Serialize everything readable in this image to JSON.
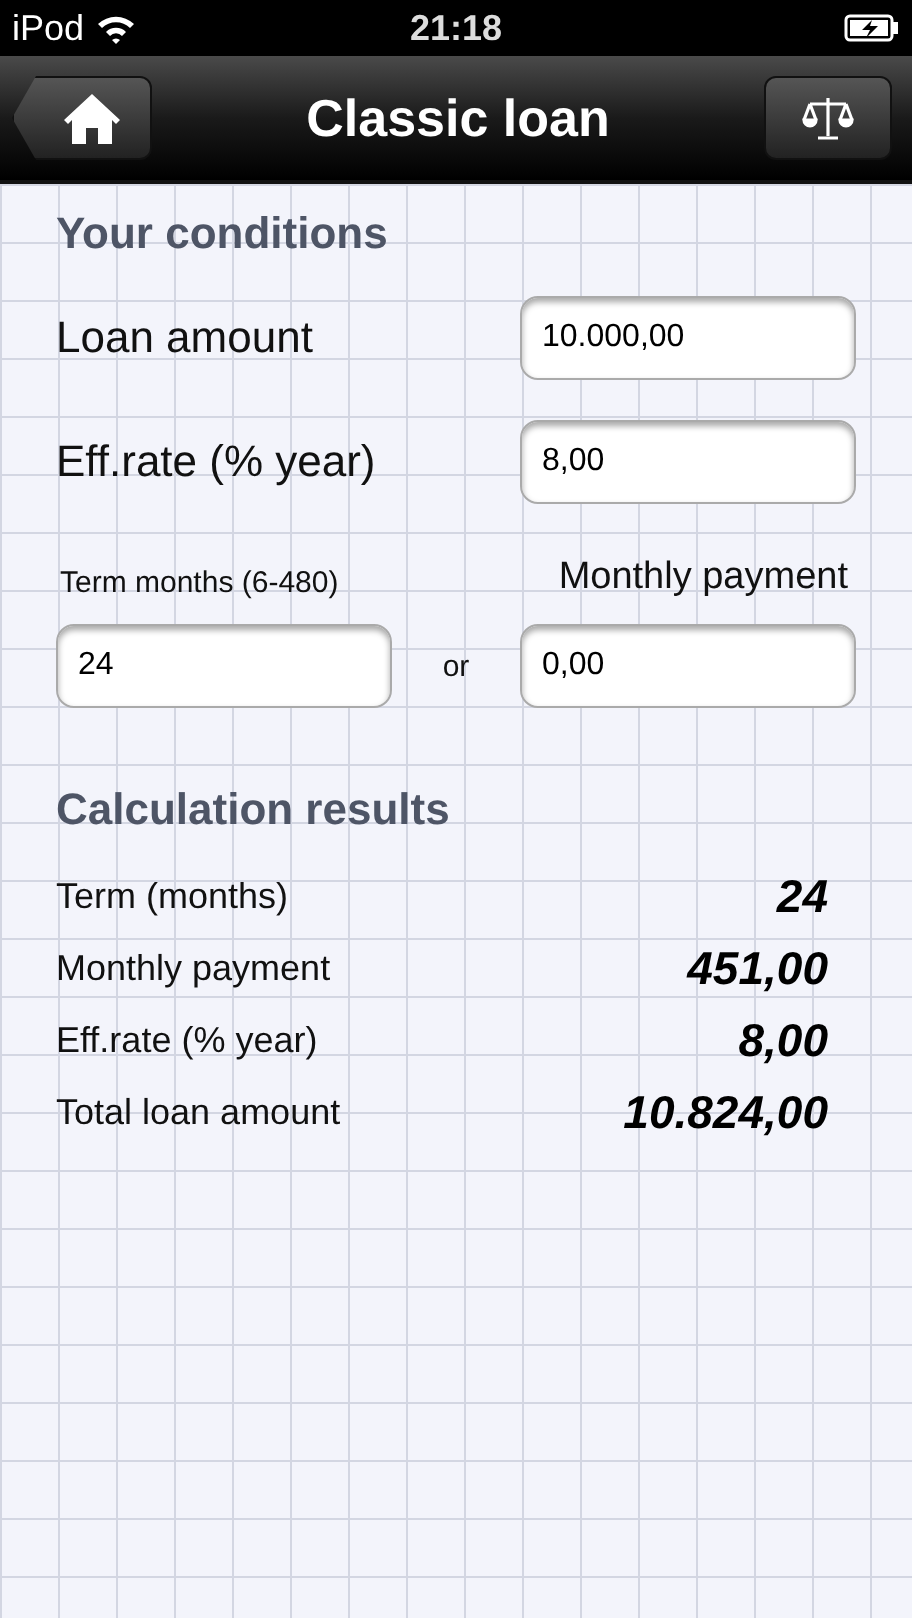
{
  "status_bar": {
    "carrier": "iPod",
    "time": "21:18"
  },
  "nav_bar": {
    "title": "Classic loan"
  },
  "conditions": {
    "heading": "Your conditions",
    "fields": [
      {
        "label": "Loan amount",
        "value": "10.000,00"
      },
      {
        "label": "Eff.rate (% year)",
        "value": "8,00"
      }
    ],
    "term": {
      "label": "Term months (6-480)",
      "value": "24"
    },
    "separator": "or",
    "payment": {
      "label": "Monthly payment",
      "value": "0,00"
    }
  },
  "results": {
    "heading": "Calculation results",
    "rows": [
      {
        "label": "Term (months)",
        "value": "24"
      },
      {
        "label": "Monthly payment",
        "value": "451,00"
      },
      {
        "label": "Eff.rate (% year)",
        "value": "8,00"
      },
      {
        "label": "Total loan amount",
        "value": "10.824,00"
      }
    ]
  }
}
